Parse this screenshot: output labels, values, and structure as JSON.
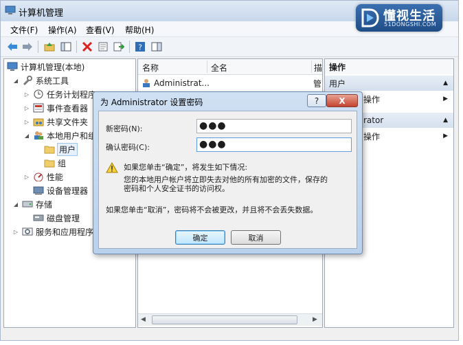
{
  "window": {
    "title": "计算机管理"
  },
  "menu": [
    "文件(F)",
    "操作(A)",
    "查看(V)",
    "帮助(H)"
  ],
  "tree": {
    "items": [
      {
        "label": "计算机管理(本地)",
        "icon": "computer-icon",
        "exp": ""
      },
      {
        "label": "系统工具",
        "icon": "tools-icon",
        "exp": "◢"
      },
      {
        "label": "任务计划程序",
        "icon": "clock-icon",
        "exp": "▷"
      },
      {
        "label": "事件查看器",
        "icon": "event-viewer-icon",
        "exp": "▷"
      },
      {
        "label": "共享文件夹",
        "icon": "shared-folder-icon",
        "exp": "▷"
      },
      {
        "label": "本地用户和组",
        "icon": "users-icon",
        "exp": "◢"
      },
      {
        "label": "用户",
        "icon": "folder-icon",
        "exp": ""
      },
      {
        "label": "组",
        "icon": "folder-icon",
        "exp": ""
      },
      {
        "label": "性能",
        "icon": "performance-icon",
        "exp": "▷"
      },
      {
        "label": "设备管理器",
        "icon": "device-manager-icon",
        "exp": ""
      },
      {
        "label": "存储",
        "icon": "storage-icon",
        "exp": "◢"
      },
      {
        "label": "磁盘管理",
        "icon": "disk-icon",
        "exp": ""
      },
      {
        "label": "服务和应用程序",
        "icon": "services-icon",
        "exp": "▷"
      }
    ]
  },
  "list": {
    "columns": [
      "名称",
      "全名",
      "描"
    ],
    "rows": [
      {
        "name": "Administrat...",
        "desc": "管"
      }
    ]
  },
  "actions": {
    "header": "操作",
    "section1": "用户",
    "item1": "操作",
    "section2": "rator",
    "item2": "操作"
  },
  "logo": {
    "main": "懂视生活",
    "sub": "51DONGSHI.COM"
  },
  "dialog": {
    "title": "为 Administrator 设置密码",
    "help_label": "?",
    "close_label": "X",
    "new_password_label": "新密码(N):",
    "new_password_value": "●●●",
    "confirm_password_label": "确认密码(C):",
    "confirm_password_value": "●●●",
    "warning_line1": "如果您单击“确定”，将发生如下情况:",
    "warning_line2": "您的本地用户帐户将立即失去对他的所有加密的文件，保存的",
    "warning_line3": "密码和个人安全证书的访问权。",
    "cancel_note": "如果您单击“取消”，密码将不会被更改，并且将不会丢失数据。",
    "ok_label": "确定",
    "cancel_label": "取消"
  }
}
